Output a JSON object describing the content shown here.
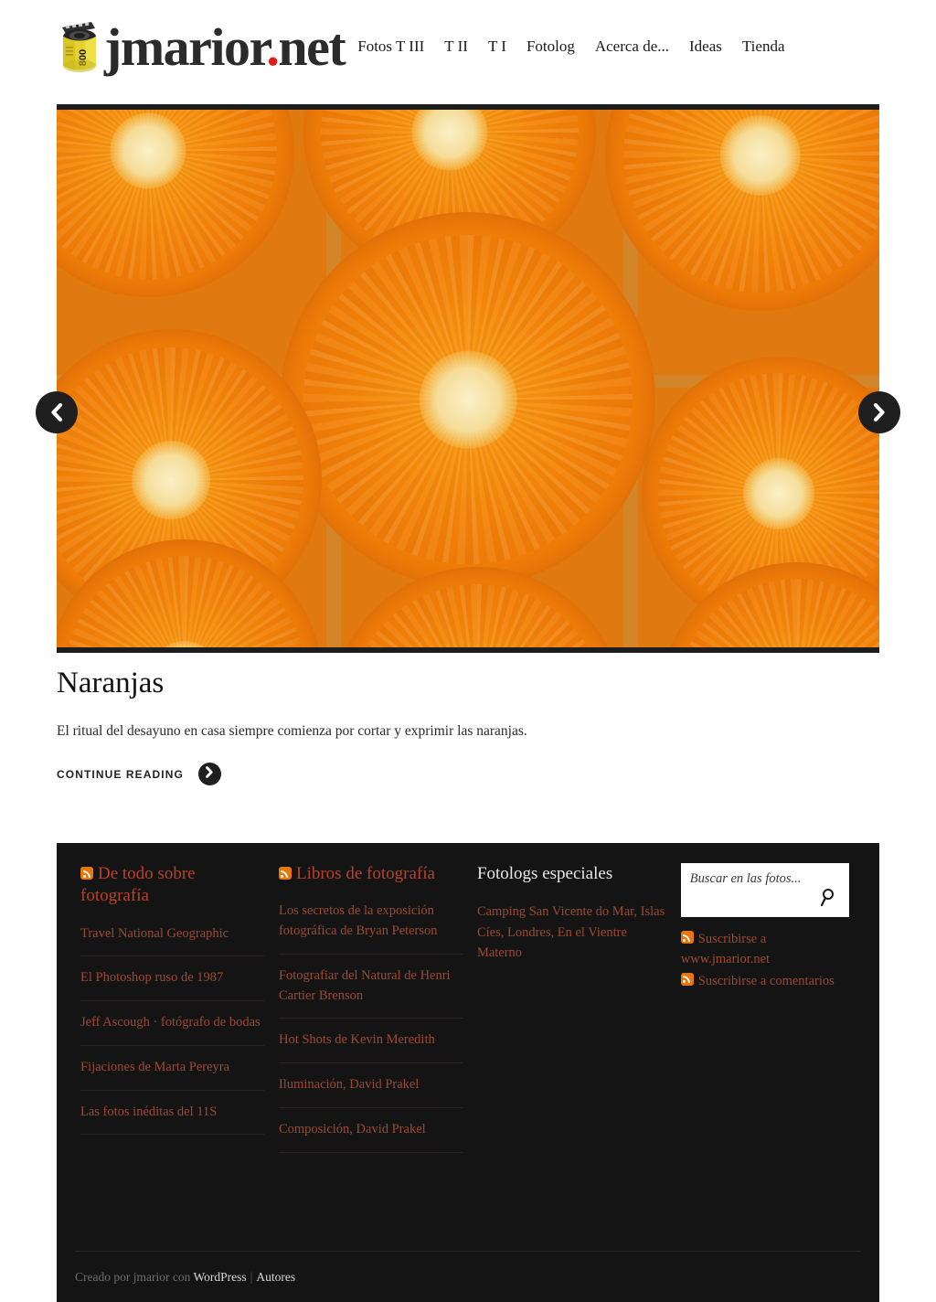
{
  "header": {
    "logo_icon": "film-canister-icon",
    "logo_film_label": "800",
    "site_title_main": "jmarior",
    "site_title_dot": ".",
    "site_title_tld": "net",
    "nav": [
      {
        "label": "Fotos T III"
      },
      {
        "label": "T II"
      },
      {
        "label": "T I"
      },
      {
        "label": "Fotolog"
      },
      {
        "label": "Acerca de..."
      },
      {
        "label": "Ideas"
      },
      {
        "label": "Tienda"
      }
    ]
  },
  "slider": {
    "prev_icon": "chevron-left-icon",
    "next_icon": "chevron-right-icon",
    "image_alt": "Naranjas cortadas por la mitad"
  },
  "entry": {
    "title": "Naranjas",
    "excerpt": "El ritual del desayuno en casa siempre comienza por cortar y exprimir las naranjas.",
    "continue_label": "CONTINUE READING",
    "continue_icon": "chevron-right-icon"
  },
  "footer": {
    "widgets": [
      {
        "title": "De todo sobre fotografía",
        "has_rss": true,
        "items": [
          "Travel National Geographic",
          "El Photoshop ruso de 1987",
          "Jeff Ascough · fotógrafo de bodas",
          "Fijaciones de Marta Pereyra",
          "Las fotos inéditas del 11S"
        ]
      },
      {
        "title": "Libros de fotografía",
        "has_rss": true,
        "items": [
          "Los secretos de la exposición fotográfica de Bryan Peterson",
          "Fotografiar del Natural de Henri Cartier Brenson",
          "Hot Shots de Kevin Meredith",
          "Iluminación, David Prakel",
          "Composición, David Prakel"
        ]
      },
      {
        "title": "Fotologs especiales",
        "has_rss": false,
        "links": [
          "Camping San Vicente do Mar",
          "Islas Cíes",
          "Londres",
          "En el Vientre Materno"
        ],
        "separator": ", "
      }
    ],
    "search": {
      "placeholder": "Buscar en las fotos...",
      "value": "",
      "icon": "search-icon"
    },
    "subscribe": [
      {
        "label": "Suscribirse a www.jmarior.net",
        "icon": "rss-icon"
      },
      {
        "label": "Suscribirse a comentarios",
        "icon": "rss-icon"
      }
    ],
    "credit": {
      "prefix": "Creado por jmarior con",
      "platform": "WordPress",
      "pipe": "|",
      "authors": "Autores"
    }
  },
  "colors": {
    "accent_red": "#b8422c",
    "link_rust": "#9c4a32",
    "rss_orange": "#e8760c",
    "footer_bg": "#141414",
    "logo_dot": "#e01b1b"
  }
}
